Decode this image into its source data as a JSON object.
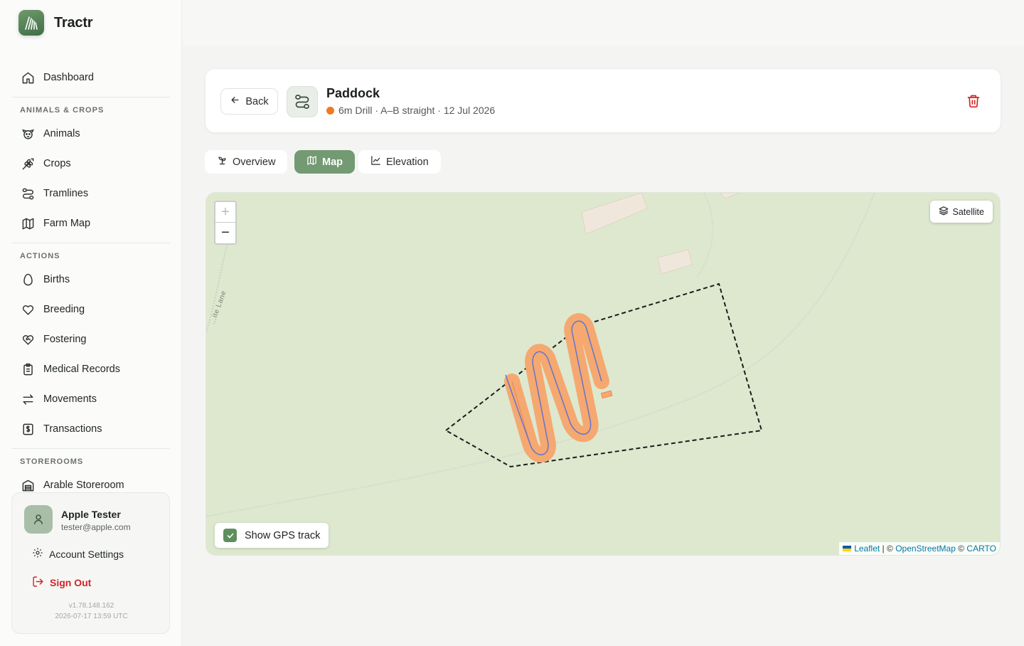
{
  "app": {
    "name": "Tractr"
  },
  "sidebar": {
    "dashboard": "Dashboard",
    "sections": {
      "animals_crops": "ANIMALS & CROPS",
      "actions": "ACTIONS",
      "storerooms": "STOREROOMS"
    },
    "items": {
      "animals": "Animals",
      "crops": "Crops",
      "tramlines": "Tramlines",
      "farm_map": "Farm Map",
      "births": "Births",
      "breeding": "Breeding",
      "fostering": "Fostering",
      "medical": "Medical Records",
      "movements": "Movements",
      "transactions": "Transactions",
      "arable_storeroom": "Arable Storeroom"
    },
    "user": {
      "name": "Apple Tester",
      "email": "tester@apple.com",
      "account_settings": "Account Settings",
      "sign_out": "Sign Out",
      "version": "v1.78.148.162",
      "build_time": "2026-07-17 13:59 UTC"
    }
  },
  "header": {
    "back_label": "Back",
    "title": "Paddock",
    "subtitle": "6m Drill · A–B straight · 12 Jul 2026",
    "status_color": "#f07a22"
  },
  "tabs": {
    "overview": "Overview",
    "map": "Map",
    "elevation": "Elevation",
    "active": "map"
  },
  "map": {
    "zoom_in": "+",
    "zoom_out": "−",
    "satellite_label": "Satellite",
    "gps_toggle_label": "Show GPS track",
    "gps_checked": true,
    "road_label": "…ite Lane",
    "attribution": {
      "leaflet": "Leaflet",
      "sep1": " | © ",
      "osm": "OpenStreetMap",
      "sep2": " © ",
      "carto": "CARTO"
    }
  },
  "colors": {
    "accent": "#739a72",
    "danger": "#d42323",
    "track": "#f5a870"
  }
}
